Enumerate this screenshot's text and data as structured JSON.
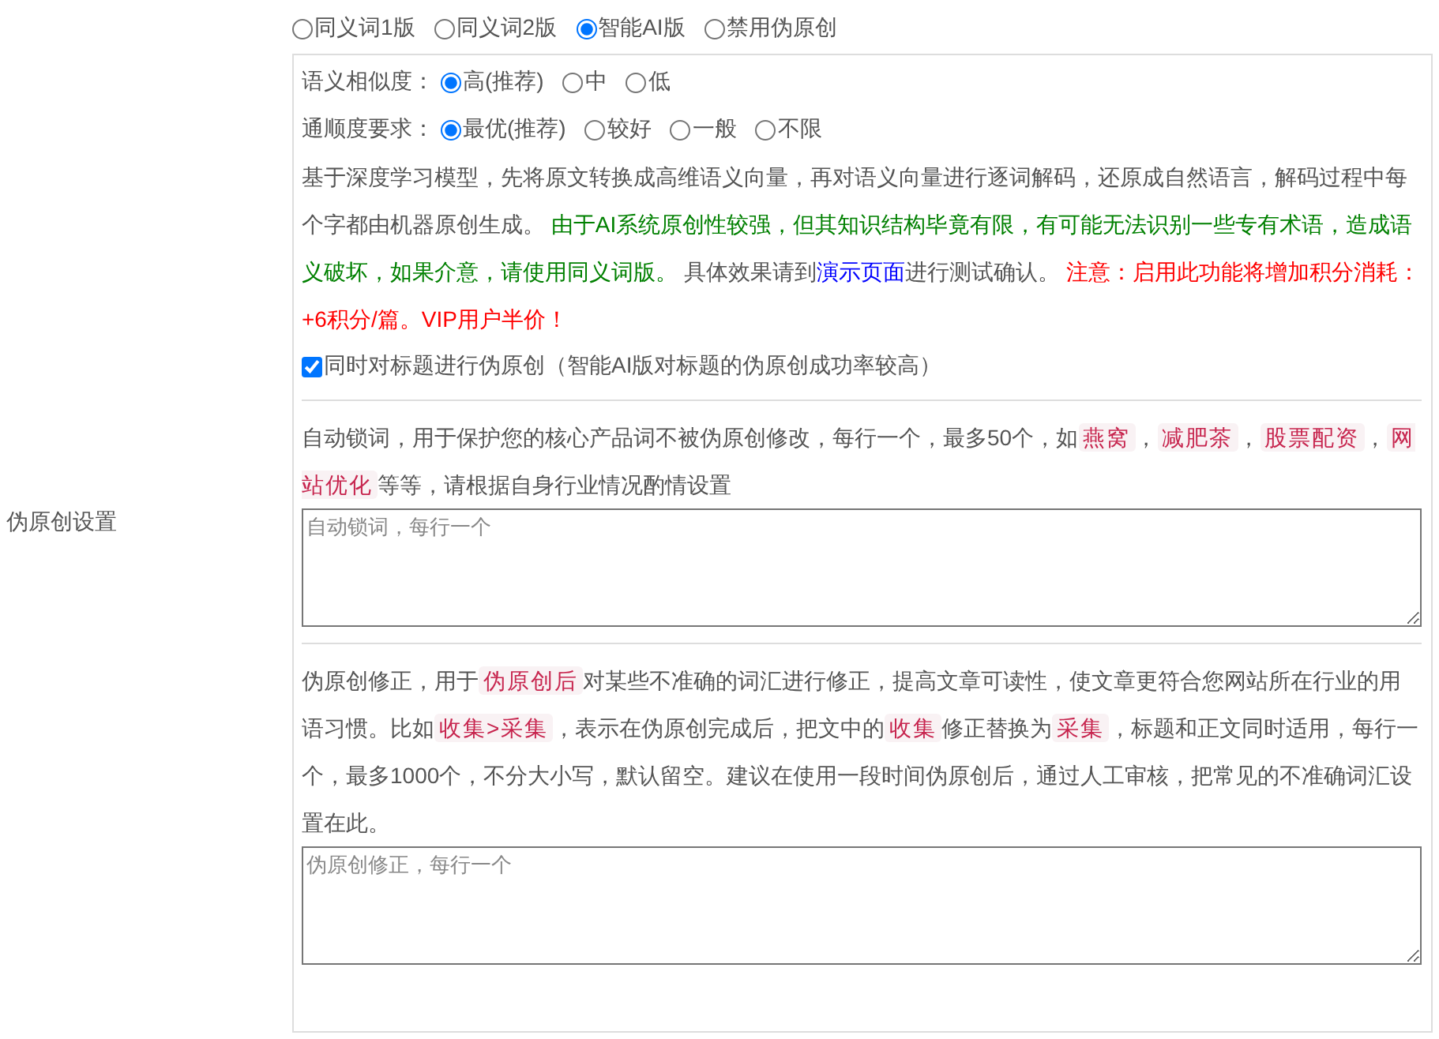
{
  "section_label": "伪原创设置",
  "modes": [
    {
      "label": "同义词1版",
      "selected": false
    },
    {
      "label": "同义词2版",
      "selected": false
    },
    {
      "label": "智能AI版",
      "selected": true
    },
    {
      "label": "禁用伪原创",
      "selected": false
    }
  ],
  "similarity": {
    "label": "语义相似度：",
    "options": [
      {
        "label": "高(推荐)",
        "selected": true
      },
      {
        "label": "中",
        "selected": false
      },
      {
        "label": "低",
        "selected": false
      }
    ]
  },
  "fluency": {
    "label": "通顺度要求：",
    "options": [
      {
        "label": "最优(推荐)",
        "selected": true
      },
      {
        "label": "较好",
        "selected": false
      },
      {
        "label": "一般",
        "selected": false
      },
      {
        "label": "不限",
        "selected": false
      }
    ]
  },
  "ai_description": [
    {
      "kind": "plain",
      "text": "基于深度学习模型，先将原文转换成高维语义向量，再对语义向量进行逐词解码，还原成自然语言，解码过程中每个字都由机器原创生成。 "
    },
    {
      "kind": "green",
      "text": "由于AI系统原创性较强，但其知识结构毕竟有限，有可能无法识别一些专有术语，造成语义破坏，如果介意，请使用同义词版。"
    },
    {
      "kind": "plain",
      "text": " 具体效果请到"
    },
    {
      "kind": "link",
      "text": "演示页面"
    },
    {
      "kind": "plain",
      "text": "进行测试确认。 "
    },
    {
      "kind": "red",
      "text": "注意：启用此功能将增加积分消耗：+6积分/篇。VIP用户半价！"
    }
  ],
  "title_option": {
    "label": "同时对标题进行伪原创（智能AI版对标题的伪原创成功率较高）",
    "checked": true
  },
  "lock_words": {
    "description": [
      {
        "kind": "plain",
        "text": "自动锁词，用于保护您的核心产品词不被伪原创修改，每行一个，最多50个，如"
      },
      {
        "kind": "tag",
        "text": "燕窝"
      },
      {
        "kind": "plain",
        "text": "，"
      },
      {
        "kind": "tag",
        "text": "减肥茶"
      },
      {
        "kind": "plain",
        "text": "，"
      },
      {
        "kind": "tag",
        "text": "股票配资"
      },
      {
        "kind": "plain",
        "text": "，"
      },
      {
        "kind": "tag",
        "text": "网站优化"
      },
      {
        "kind": "plain",
        "text": "等等，请根据自身行业情况酌情设置"
      }
    ],
    "placeholder": "自动锁词，每行一个"
  },
  "correction": {
    "description": [
      {
        "kind": "plain",
        "text": "伪原创修正，用于"
      },
      {
        "kind": "tag",
        "text": "伪原创后"
      },
      {
        "kind": "plain",
        "text": "对某些不准确的词汇进行修正，提高文章可读性，使文章更符合您网站所在行业的用语习惯。比如"
      },
      {
        "kind": "tag",
        "text": "收集>采集"
      },
      {
        "kind": "plain",
        "text": "，表示在伪原创完成后，把文中的"
      },
      {
        "kind": "tag",
        "text": "收集"
      },
      {
        "kind": "plain",
        "text": "修正替换为"
      },
      {
        "kind": "tag",
        "text": "采集"
      },
      {
        "kind": "plain",
        "text": "，标题和正文同时适用，每行一个，最多1000个，不分大小写，默认留空。建议在使用一段时间伪原创后，通过人工审核，把常见的不准确词汇设置在此。"
      }
    ],
    "placeholder": "伪原创修正，每行一个"
  }
}
